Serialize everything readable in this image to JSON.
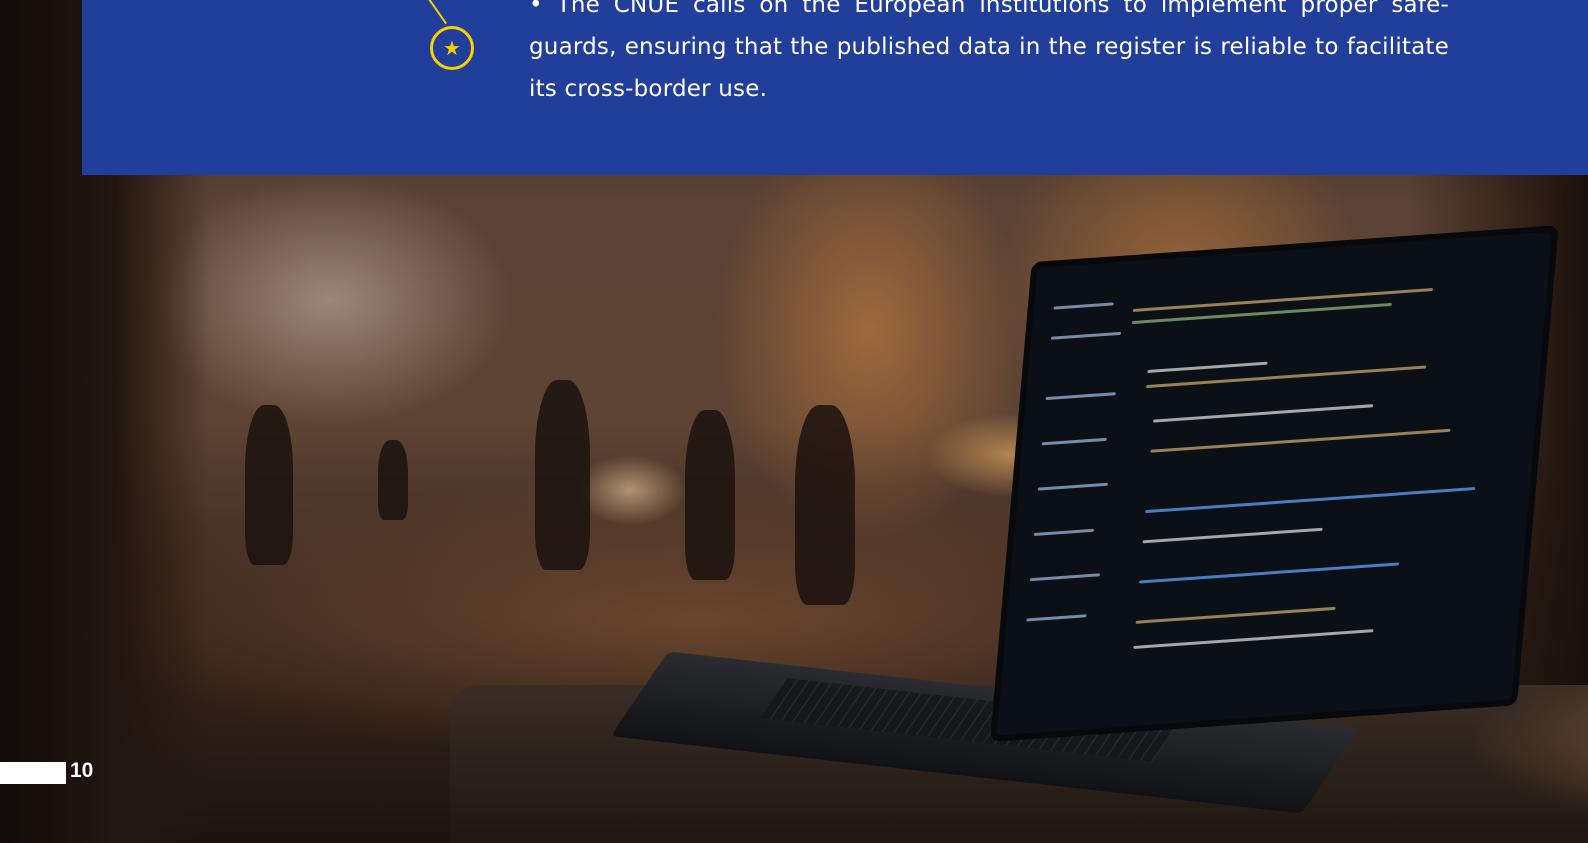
{
  "panel": {
    "text": "• The CNUE calls on the European institutions to implement proper safe-guards, ensuring that the published data in the register is reliable to facilitate its cross-border use.",
    "badge_icon": "star-icon",
    "color": "#213e9a",
    "accent_color": "#f5d200"
  },
  "footer": {
    "page_number": "10"
  }
}
